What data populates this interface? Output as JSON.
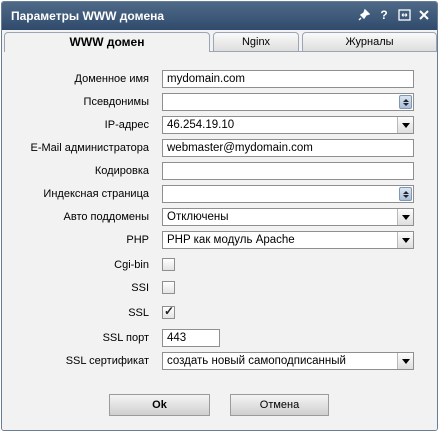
{
  "window": {
    "title": "Параметры WWW домена",
    "icons": [
      "pin-icon",
      "help-icon",
      "restore-icon",
      "close-icon"
    ]
  },
  "tabs": [
    {
      "label": "WWW домен",
      "active": true
    },
    {
      "label": "Nginx",
      "active": false
    },
    {
      "label": "Журналы",
      "active": false
    }
  ],
  "form": {
    "domain_name": {
      "label": "Доменное имя",
      "value": "mydomain.com"
    },
    "aliases": {
      "label": "Псевдонимы",
      "value": ""
    },
    "ip_address": {
      "label": "IP-адрес",
      "value": "46.254.19.10"
    },
    "admin_email": {
      "label": "E-Mail администратора",
      "value": "webmaster@mydomain.com"
    },
    "encoding": {
      "label": "Кодировка",
      "value": ""
    },
    "index_page": {
      "label": "Индексная страница",
      "value": ""
    },
    "auto_subdomains": {
      "label": "Авто поддомены",
      "value": "Отключены"
    },
    "php": {
      "label": "PHP",
      "value": "PHP как модуль Apache"
    },
    "cgi_bin": {
      "label": "Cgi-bin",
      "checked": false
    },
    "ssi": {
      "label": "SSI",
      "checked": false
    },
    "ssl": {
      "label": "SSL",
      "checked": true
    },
    "ssl_port": {
      "label": "SSL порт",
      "value": "443"
    },
    "ssl_certificate": {
      "label": "SSL сертификат",
      "value": "создать новый самоподписанный"
    }
  },
  "buttons": {
    "ok": "Ok",
    "cancel": "Отмена"
  },
  "colors": {
    "titlebar": "#3f5a7a",
    "background": "#f2f2f2"
  }
}
